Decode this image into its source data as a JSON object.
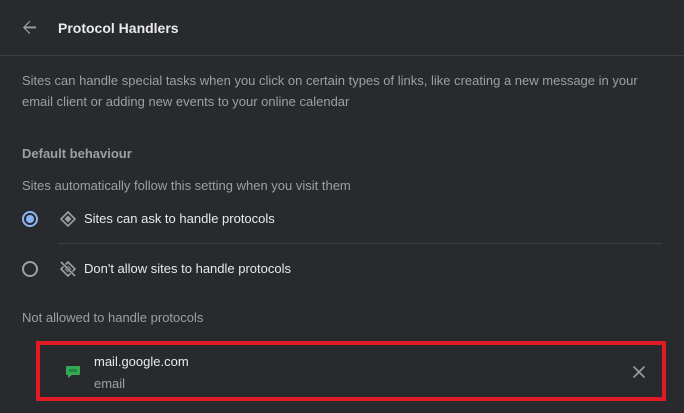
{
  "header": {
    "back_icon": "arrow-left-icon",
    "title": "Protocol Handlers"
  },
  "description": "Sites can handle special tasks when you click on certain types of links, like creating a new message in your email client or adding new events to your online calendar",
  "default_behaviour": {
    "heading": "Default behaviour",
    "subtitle": "Sites automatically follow this setting when you visit them",
    "options": [
      {
        "label": "Sites can ask to handle protocols",
        "icon": "protocol-handler-icon",
        "selected": true
      },
      {
        "label": "Don't allow sites to handle protocols",
        "icon": "protocol-handler-off-icon",
        "selected": false
      }
    ]
  },
  "not_allowed": {
    "heading": "Not allowed to handle protocols",
    "sites": [
      {
        "site": "mail.google.com",
        "protocol": "email",
        "icon": "google-chat-icon",
        "remove_icon": "close-icon"
      }
    ]
  },
  "colors": {
    "background": "#292a2d",
    "accent": "#8ab4f8",
    "highlight_border": "#e01b24",
    "site_icon": "#34a853"
  }
}
